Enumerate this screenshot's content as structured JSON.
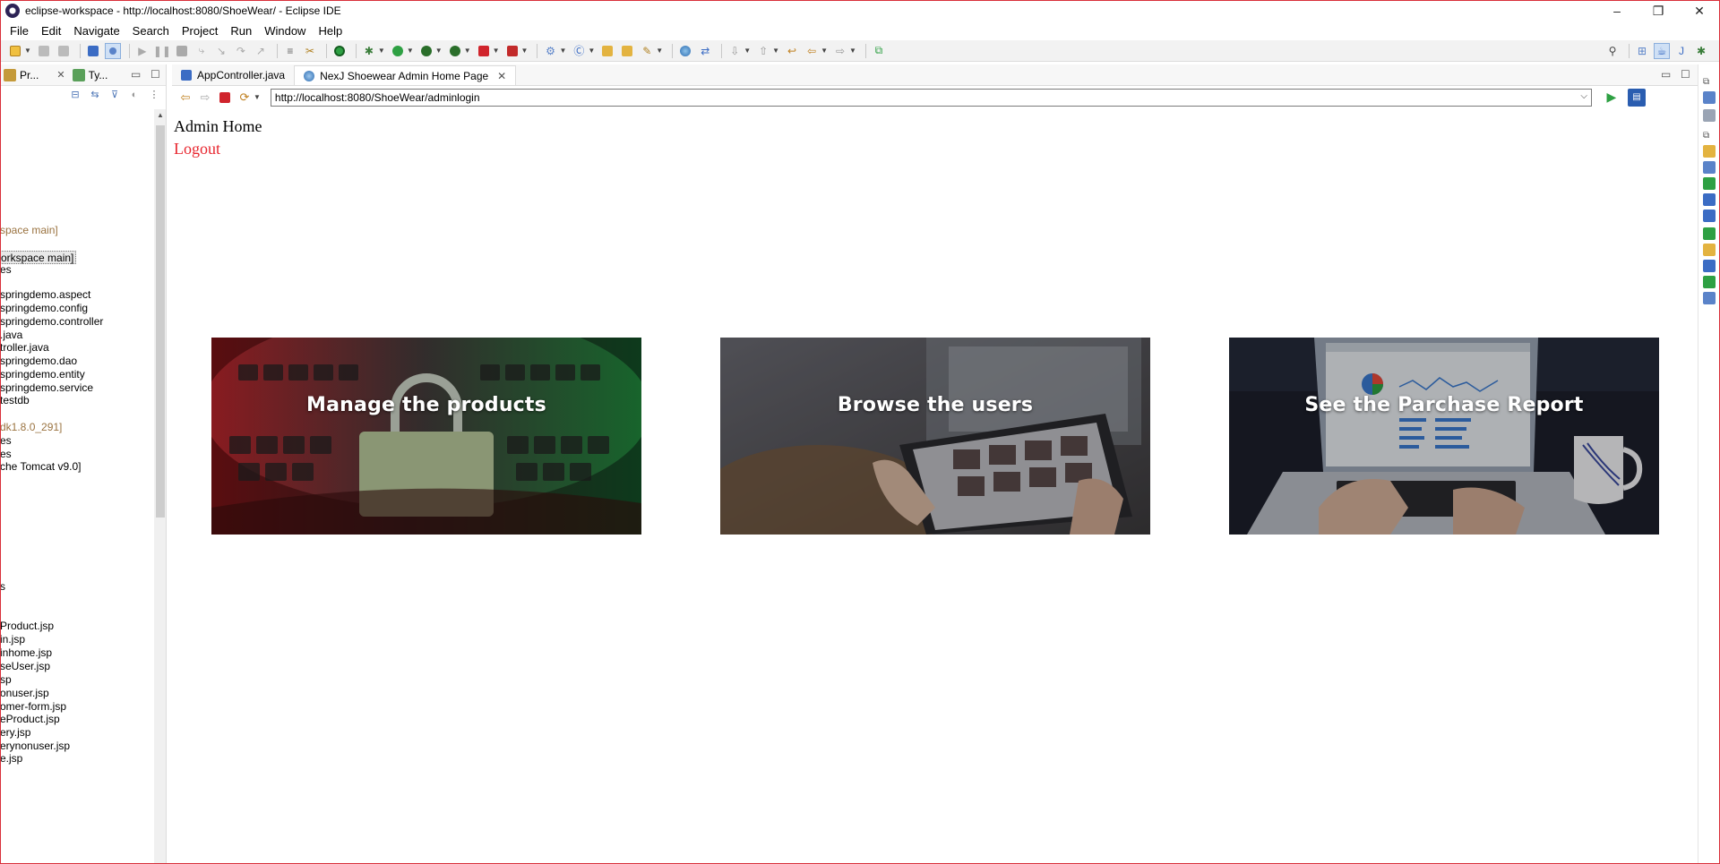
{
  "window": {
    "title": "eclipse-workspace - http://localhost:8080/ShoeWear/ - Eclipse IDE",
    "minimize": "–",
    "restore": "❐",
    "close": "✕"
  },
  "menu": [
    "File",
    "Edit",
    "Navigate",
    "Search",
    "Project",
    "Run",
    "Window",
    "Help"
  ],
  "left_panel": {
    "tabs": [
      {
        "label": "Pr...",
        "icon": "project-explorer-icon"
      },
      {
        "label": "Ty...",
        "icon": "type-hierarchy-icon"
      }
    ],
    "tree": [
      {
        "text": "space main]",
        "style": "brown"
      },
      {
        "text": "orkspace main]",
        "style": "selected"
      },
      {
        "text": "es",
        "style": ""
      },
      {
        "text": "springdemo.aspect",
        "style": ""
      },
      {
        "text": "springdemo.config",
        "style": ""
      },
      {
        "text": "springdemo.controller",
        "style": ""
      },
      {
        "text": ".java",
        "style": ""
      },
      {
        "text": "troller.java",
        "style": ""
      },
      {
        "text": "springdemo.dao",
        "style": ""
      },
      {
        "text": "springdemo.entity",
        "style": ""
      },
      {
        "text": "springdemo.service",
        "style": ""
      },
      {
        "text": "testdb",
        "style": ""
      },
      {
        "text": "dk1.8.0_291]",
        "style": "brown"
      },
      {
        "text": "es",
        "style": ""
      },
      {
        "text": "es",
        "style": ""
      },
      {
        "text": "che Tomcat v9.0]",
        "style": ""
      },
      {
        "text": "s",
        "style": ""
      },
      {
        "text": "Product.jsp",
        "style": ""
      },
      {
        "text": "in.jsp",
        "style": ""
      },
      {
        "text": "inhome.jsp",
        "style": ""
      },
      {
        "text": "seUser.jsp",
        "style": ""
      },
      {
        "text": "sp",
        "style": ""
      },
      {
        "text": "onuser.jsp",
        "style": ""
      },
      {
        "text": "omer-form.jsp",
        "style": ""
      },
      {
        "text": "eProduct.jsp",
        "style": ""
      },
      {
        "text": "ery.jsp",
        "style": ""
      },
      {
        "text": "erynonuser.jsp",
        "style": ""
      },
      {
        "text": "e.jsp",
        "style": ""
      }
    ]
  },
  "editor": {
    "tabs": [
      {
        "label": "AppController.java",
        "active": false
      },
      {
        "label": "NexJ Shoewear Admin Home Page",
        "active": true
      }
    ],
    "url": "http://localhost:8080/ShoeWear/adminlogin"
  },
  "page": {
    "title": "Admin Home",
    "logout": "Logout",
    "cards": [
      {
        "title": "Manage the products"
      },
      {
        "title": "Browse the users"
      },
      {
        "title": "See the Parchase Report"
      }
    ]
  },
  "colors": {
    "logout_link": "#e8262f",
    "window_border": "#d9303a",
    "tree_brown": "#9a7340"
  }
}
